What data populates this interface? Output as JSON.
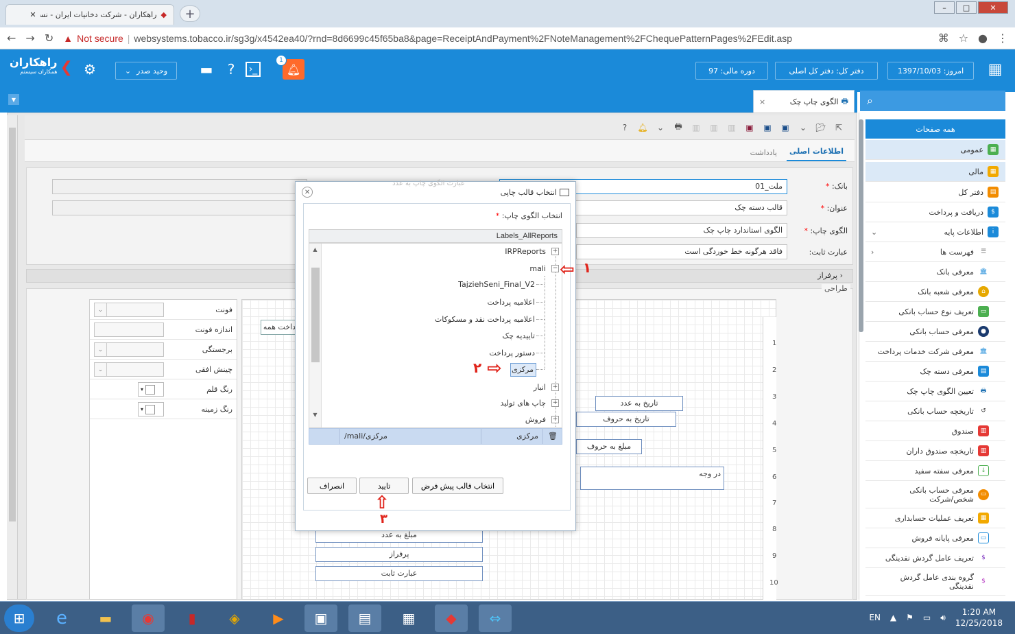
{
  "browser": {
    "tab_title": "راهکاران - شرکت دخانیات ایران - نسخه",
    "security": "Not secure",
    "url": "websystems.tobacco.ir/sg3g/x4542ea40/?rnd=8d6699c45f65ba8&page=ReceiptAndPayment%2FNoteManagement%2FChequePatternPages%2FEdit.aspx"
  },
  "header": {
    "logo": "راهکاران",
    "logo_sub": "همکاران سیستم",
    "unit_select": "وحید صدر",
    "notif_count": "1",
    "today": "امروز: 1397/10/03",
    "ledger": "دفتر کل: دفتر کل اصلی",
    "fiscal": "دوره مالی: 97"
  },
  "page_tab": {
    "label": "الگوی چاپ چک",
    "close": "×"
  },
  "form_tabs": [
    "اطلاعات اصلی",
    "یادداشت"
  ],
  "form": {
    "bank_label": "بانک:",
    "bank_value": "ملت_01",
    "title_label": "عنوان:",
    "title_value": "قالب دسته چک",
    "pattern_label": "الگوی چاپ:",
    "pattern_value": "الگوی استاندارد چاپ چک",
    "fixed_label": "عبارت ثابت:",
    "fixed_value": "فاقد هرگونه خط خوردگی است",
    "required": "*"
  },
  "section": {
    "parraz": "پرفراز",
    "design": "طراحی"
  },
  "props": {
    "font": "فونت",
    "font_size": "اندازه فونت",
    "bold": "برجستگی",
    "halign": "چینش افقی",
    "pen_color": "رنگ قلم",
    "bg_color": "رنگ زمینه"
  },
  "canvas": {
    "f1": "تاریخ به عدد",
    "f2": "تاریخ به حروف",
    "f3": "مبلغ به حروف",
    "f4": "در وجه",
    "f5": "مبلغ به عدد",
    "f6": "پرفراز",
    "f7": "عبارت ثابت",
    "f8": "پرداخت همه",
    "ruler": [
      "1",
      "2",
      "3",
      "4",
      "5",
      "6",
      "7",
      "8",
      "9",
      "10"
    ]
  },
  "dialog": {
    "title": "انتخاب قالب چاپی",
    "faded": "عبارت الگوی چاپ به عدد",
    "tree_label": "انتخاب الگوی چاپ:",
    "tree_root": "Labels_AllReports",
    "nodes": {
      "irp": "IRPReports",
      "mali": "mali",
      "tajz": "TajziehSeni_Final_V2",
      "elam": "اعلامیه پرداخت",
      "elamn": "اعلامیه پرداخت نقد و مسکوکات",
      "tayid": "تاییدیه چک",
      "dastoor": "دستور پرداخت",
      "markazi": "مرکزی",
      "anbar": "انبار",
      "chap": "چاپ های تولید",
      "foroosh": "فروش"
    },
    "sel_name": "مرکزی",
    "sel_path": "/mali/مرکزی",
    "btn_default": "انتخاب قالب پیش فرض",
    "btn_ok": "تایید",
    "btn_cancel": "انصراف"
  },
  "annotations": [
    "۱",
    "۲",
    "۳"
  ],
  "sidebar": {
    "header": "همه صفحات",
    "items": [
      "عمومی",
      "مالی",
      "دفتر کل",
      "دریافت و پرداخت",
      "اطلاعات پایه",
      "فهرست ها",
      "معرفی بانک",
      "معرفی شعبه بانک",
      "تعریف نوع حساب بانکی",
      "معرفی حساب بانکی",
      "معرفی شرکت خدمات پرداخت",
      "معرفی دسته چک",
      "تعیین الگوی چاپ چک",
      "تاریخچه حساب بانکی",
      "صندوق",
      "تاریخچه صندوق داران",
      "معرفی سفته سفید",
      "معرفی حساب بانکی شخص/شرکت",
      "تعریف عملیات حسابداری",
      "معرفی پایانه فروش",
      "تعریف عامل گردش نقدینگی",
      "گروه بندی عامل گردش نقدینگی"
    ]
  },
  "taskbar": {
    "lang": "EN",
    "time": "1:20 AM",
    "date": "12/25/2018"
  },
  "colors": {
    "brand": "#1b8ad9",
    "accent": "#ff6a2b",
    "annotation": "#e0241b"
  }
}
